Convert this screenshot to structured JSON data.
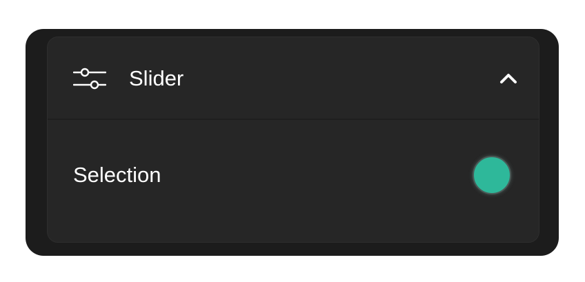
{
  "panel": {
    "title": "Slider",
    "title_icon": "sliders-icon",
    "toggle_icon": "chevron-up-icon",
    "expanded": true
  },
  "selection": {
    "label": "Selection",
    "color": "#2eb89a"
  },
  "colors": {
    "frame": "#1c1c1c",
    "panel": "#262626",
    "text": "#ffffff",
    "accent": "#2eb89a"
  }
}
